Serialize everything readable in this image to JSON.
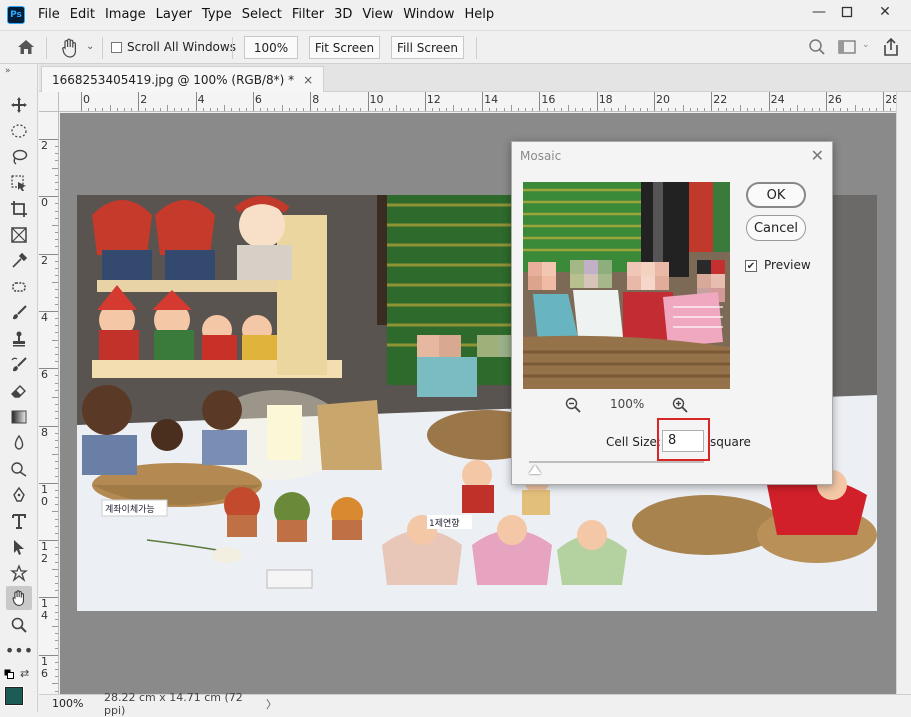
{
  "app": {
    "logo_text": "Ps",
    "menu": [
      "File",
      "Edit",
      "Image",
      "Layer",
      "Type",
      "Select",
      "Filter",
      "3D",
      "View",
      "Window",
      "Help"
    ]
  },
  "options_bar": {
    "scroll_all_windows": "Scroll All Windows",
    "zoom_100": "100%",
    "fit_screen": "Fit Screen",
    "fill_screen": "Fill Screen"
  },
  "document": {
    "tab_title": "1668253405419.jpg @ 100% (RGB/8*) *",
    "tab_close": "×"
  },
  "rulers": {
    "top": [
      "0",
      "2",
      "4",
      "6",
      "8",
      "10",
      "12",
      "14",
      "16",
      "18",
      "20",
      "22",
      "24",
      "26",
      "28"
    ],
    "left": [
      "2",
      "0",
      "2",
      "4",
      "6",
      "8",
      "1\n0",
      "1\n2",
      "1\n4",
      "1\n6"
    ]
  },
  "status": {
    "zoom": "100%",
    "doc_size": "28.22 cm x 14.71 cm (72 ppi)",
    "arrow": "〉"
  },
  "dialog": {
    "title": "Mosaic",
    "close": "✕",
    "ok": "OK",
    "cancel": "Cancel",
    "preview_label": "Preview",
    "preview_checked": true,
    "zoom_level": "100%",
    "cell_size_label": "Cell Size:",
    "cell_size_value": "8",
    "unit": "square",
    "zoom_out_icon": "zoom-out",
    "zoom_in_icon": "zoom-in"
  },
  "image_labels": {
    "sign1": "계좌이체가능",
    "sign2": "1제연향"
  },
  "colors": {
    "foreground": "#1d5c55",
    "highlight": "#d62626"
  }
}
